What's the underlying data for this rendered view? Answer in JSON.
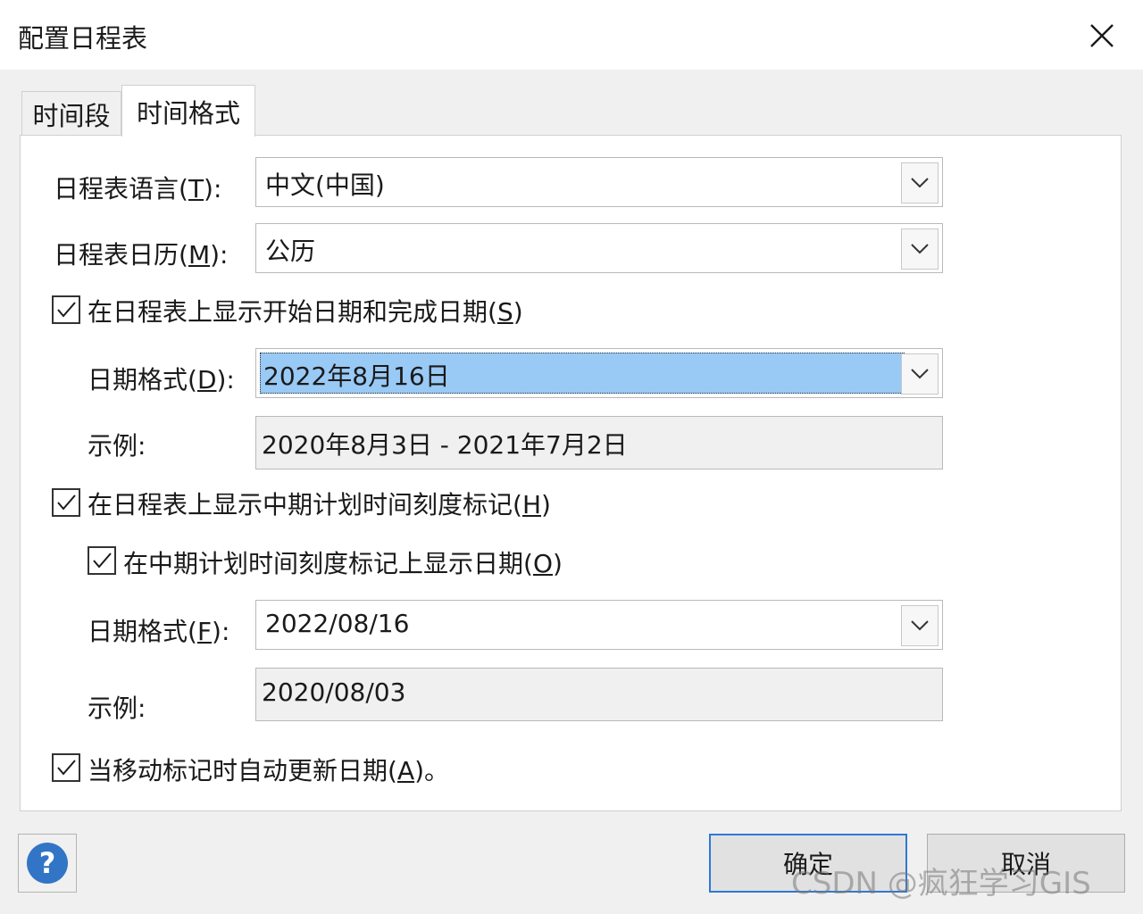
{
  "window": {
    "title": "配置日程表"
  },
  "tabs": [
    {
      "label": "时间段",
      "active": false
    },
    {
      "label": "时间格式",
      "active": true
    }
  ],
  "form": {
    "language": {
      "label_pre": "日程表语言(",
      "label_key": "T",
      "label_post": "):",
      "value": "中文(中国)"
    },
    "calendar": {
      "label_pre": "日程表日历(",
      "label_key": "M",
      "label_post": "):",
      "value": "公历"
    },
    "show_start_end": {
      "label_pre": "在日程表上显示开始日期和完成日期(",
      "label_key": "S",
      "label_post": ")",
      "checked": true
    },
    "date_format_d": {
      "label_pre": "日期格式(",
      "label_key": "D",
      "label_post": "):",
      "value": "2022年8月16日"
    },
    "example_1": {
      "label": "示例:",
      "value": "2020年8月3日 - 2021年7月2日"
    },
    "show_midterm": {
      "label_pre": "在日程表上显示中期计划时间刻度标记(",
      "label_key": "H",
      "label_post": ")",
      "checked": true
    },
    "show_midterm_date": {
      "label_pre": "在中期计划时间刻度标记上显示日期(",
      "label_key": "O",
      "label_post": ")",
      "checked": true
    },
    "date_format_f": {
      "label_pre": "日期格式(",
      "label_key": "F",
      "label_post": "):",
      "value": "2022/08/16"
    },
    "example_2": {
      "label": "示例:",
      "value": "2020/08/03"
    },
    "auto_update": {
      "label_pre": "当移动标记时自动更新日期(",
      "label_key": "A",
      "label_post": ")。",
      "checked": true
    }
  },
  "buttons": {
    "ok": "确定",
    "cancel": "取消",
    "help": "?"
  },
  "watermark": "CSDN @疯狂学习GIS",
  "colors": {
    "selection": "#99c9f5",
    "ok_border": "#2f78d4",
    "help": "#3275c6"
  }
}
